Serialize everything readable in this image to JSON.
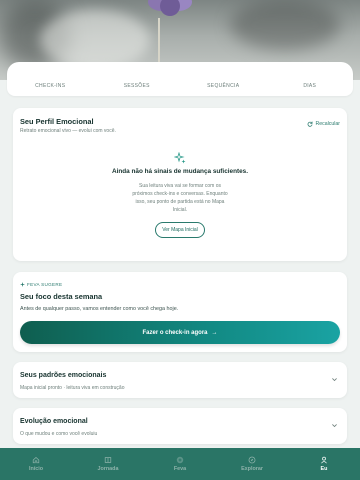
{
  "stats": [
    {
      "label": "CHECK-INS"
    },
    {
      "label": "SESSÕES"
    },
    {
      "label": "SEQUÊNCIA"
    },
    {
      "label": "DIAS"
    }
  ],
  "profile": {
    "title": "Seu Perfil Emocional",
    "subtitle": "Retrato emocional vivo — evolui com você.",
    "recalc_label": "Recalcular",
    "empty_title": "Ainda não há sinais de mudança suficientes.",
    "empty_text": "Sua leitura viva vai se formar com os próximos check-ins e conversas. Enquanto isso, seu ponto de partida está no Mapa Inicial.",
    "map_button": "Ver Mapa Inicial"
  },
  "focus": {
    "tag": "FEVA SUGERE",
    "title": "Seu foco desta semana",
    "text": "Antes de qualquer passo, vamos entender como você chega hoje.",
    "cta": "Fazer o check-in agora"
  },
  "patterns": {
    "title": "Seus padrões emocionais",
    "subtitle": "Mapa inicial pronto · leitura viva em construção"
  },
  "evolution": {
    "title": "Evolução emocional",
    "subtitle": "O que mudou e como você evoluiu"
  },
  "nav": [
    {
      "label": "Início",
      "icon": "home-icon"
    },
    {
      "label": "Jornada",
      "icon": "book-icon"
    },
    {
      "label": "Feva",
      "icon": "sparkle-icon"
    },
    {
      "label": "Explorar",
      "icon": "compass-icon"
    },
    {
      "label": "Eu",
      "icon": "user-icon",
      "active": true
    }
  ],
  "colors": {
    "accent": "#2a7566",
    "cta_start": "#0f5e4f",
    "cta_end": "#1aa3a3"
  }
}
